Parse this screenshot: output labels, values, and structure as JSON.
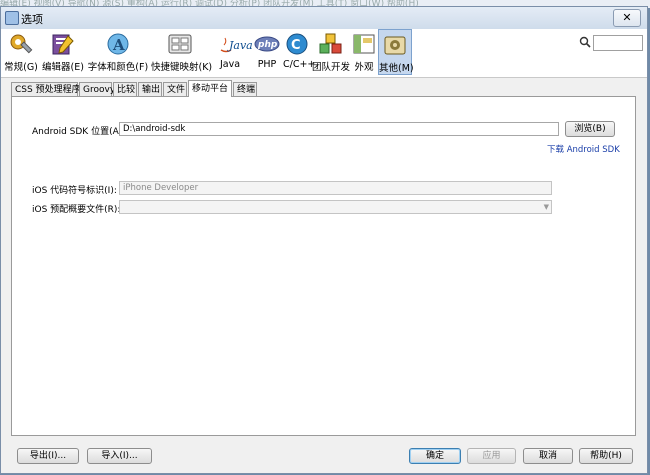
{
  "background_menu": "编辑(E)  视图(V)  导航(N)  源(S)  重构(A)  运行(R)  调试(D)  分析(P)  团队开发(M)  工具(T)  窗口(W)  帮助(H)",
  "window": {
    "title": "选项",
    "close_label": "✕"
  },
  "categories": [
    {
      "label": "常规(G)",
      "icon": "gear-wrench-icon"
    },
    {
      "label": "编辑器(E)",
      "icon": "editor-pen-icon"
    },
    {
      "label": "字体和颜色(F)",
      "icon": "font-color-icon"
    },
    {
      "label": "快捷键映射(K)",
      "icon": "keyboard-icon"
    },
    {
      "label": "Java",
      "icon": "java-icon"
    },
    {
      "label": "PHP",
      "icon": "php-icon"
    },
    {
      "label": "C/C++",
      "icon": "cpp-icon"
    },
    {
      "label": "团队开发",
      "icon": "team-cubes-icon"
    },
    {
      "label": "外观",
      "icon": "appearance-icon"
    },
    {
      "label": "其他(M)",
      "icon": "misc-icon"
    }
  ],
  "tabs": [
    "CSS 预处理程序",
    "Groovy",
    "比较",
    "输出",
    "文件",
    "移动平台",
    "终端"
  ],
  "active_tab": "移动平台",
  "android": {
    "sdk_label": "Android SDK 位置(A):",
    "sdk_value": "D:\\android-sdk",
    "browse_label": "浏览(B)",
    "download_link": "下载 Android SDK"
  },
  "ios": {
    "signing_label": "iOS 代码符号标识(I):",
    "signing_value": "iPhone Developer",
    "profile_label": "iOS 预配概要文件(R):",
    "profile_value": ""
  },
  "footer": {
    "export_label": "导出(I)...",
    "import_label": "导入(I)...",
    "ok_label": "确定",
    "apply_label": "应用",
    "cancel_label": "取消",
    "help_label": "帮助(H)"
  },
  "colors": {
    "active_bg": "#c5d7ee",
    "link": "#1a3ea8"
  }
}
